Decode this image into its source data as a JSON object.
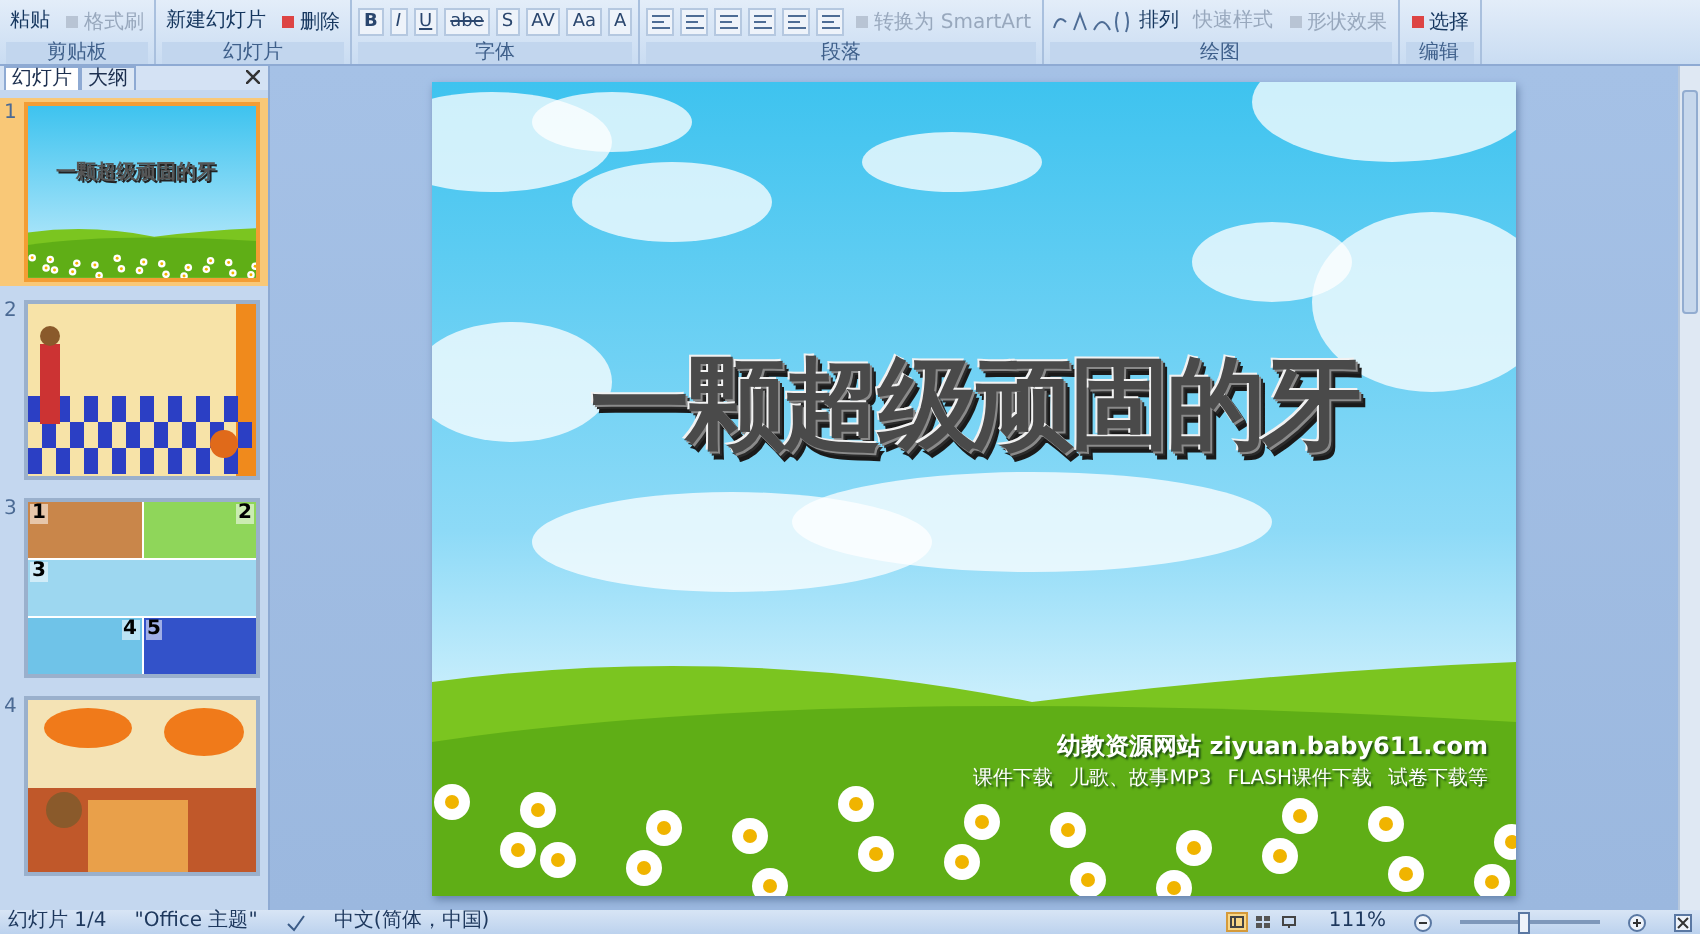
{
  "ribbon": {
    "groups": [
      {
        "label": "剪贴板",
        "items": [
          {
            "kind": "big",
            "label": "粘贴",
            "disabled": false
          },
          {
            "kind": "small",
            "label": "格式刷",
            "disabled": true
          }
        ]
      },
      {
        "label": "幻灯片",
        "items": [
          {
            "kind": "big",
            "label": "新建幻灯片",
            "disabled": false
          },
          {
            "kind": "small",
            "label": "删除",
            "disabled": false
          }
        ]
      },
      {
        "label": "字体",
        "items": [
          {
            "kind": "glyph",
            "label": "B",
            "disabled": false
          },
          {
            "kind": "glyph",
            "label": "I",
            "disabled": false
          },
          {
            "kind": "glyph",
            "label": "U",
            "disabled": false
          },
          {
            "kind": "glyph",
            "label": "abe",
            "disabled": false
          },
          {
            "kind": "glyph",
            "label": "S",
            "disabled": false
          },
          {
            "kind": "glyph",
            "label": "AV",
            "disabled": false
          },
          {
            "kind": "glyph",
            "label": "Aa",
            "disabled": false
          },
          {
            "kind": "glyph",
            "label": "A",
            "disabled": false
          }
        ]
      },
      {
        "label": "段落",
        "items": [
          {
            "kind": "tool",
            "disabled": false
          },
          {
            "kind": "tool",
            "disabled": false
          },
          {
            "kind": "tool",
            "disabled": false
          },
          {
            "kind": "tool",
            "disabled": false
          },
          {
            "kind": "tool",
            "disabled": false
          },
          {
            "kind": "tool",
            "disabled": false
          },
          {
            "kind": "small",
            "label": "转换为 SmartArt",
            "disabled": true
          }
        ]
      },
      {
        "label": "绘图",
        "items": [
          {
            "kind": "shape",
            "disabled": false
          },
          {
            "kind": "big",
            "label": "排列",
            "disabled": false
          },
          {
            "kind": "big",
            "label": "快速样式",
            "disabled": true
          },
          {
            "kind": "small",
            "label": "形状效果",
            "disabled": true
          }
        ]
      },
      {
        "label": "编辑",
        "items": [
          {
            "kind": "small",
            "label": "选择",
            "disabled": false
          }
        ]
      }
    ]
  },
  "panel": {
    "tabs": [
      {
        "label": "幻灯片",
        "selected": true
      },
      {
        "label": "大纲",
        "selected": false
      }
    ],
    "slides": [
      {
        "number": "1",
        "selected": true,
        "kind": "title",
        "title": "一颗超级顽固的牙"
      },
      {
        "number": "2",
        "selected": false,
        "kind": "room"
      },
      {
        "number": "3",
        "selected": false,
        "kind": "panels",
        "labels": [
          "1",
          "2",
          "3",
          "4",
          "5"
        ]
      },
      {
        "number": "4",
        "selected": false,
        "kind": "scenes"
      }
    ]
  },
  "slide": {
    "title": "一颗超级顽固的牙",
    "site": "幼教资源网站  ziyuan.baby611.com",
    "links": [
      "课件下载",
      "儿歌、故事MP3",
      "FLASH课件下载",
      "试卷下载等"
    ]
  },
  "status_bar": {
    "slide": "幻灯片 1/4",
    "theme": "\"Office 主题\"",
    "language": "中文(简体，中国)",
    "views": [
      {
        "kind": "normal",
        "selected": true
      },
      {
        "kind": "sorter",
        "selected": false
      },
      {
        "kind": "show",
        "selected": false
      }
    ],
    "zoom": "111%",
    "zoom_slider": {
      "level": 0.45
    }
  }
}
